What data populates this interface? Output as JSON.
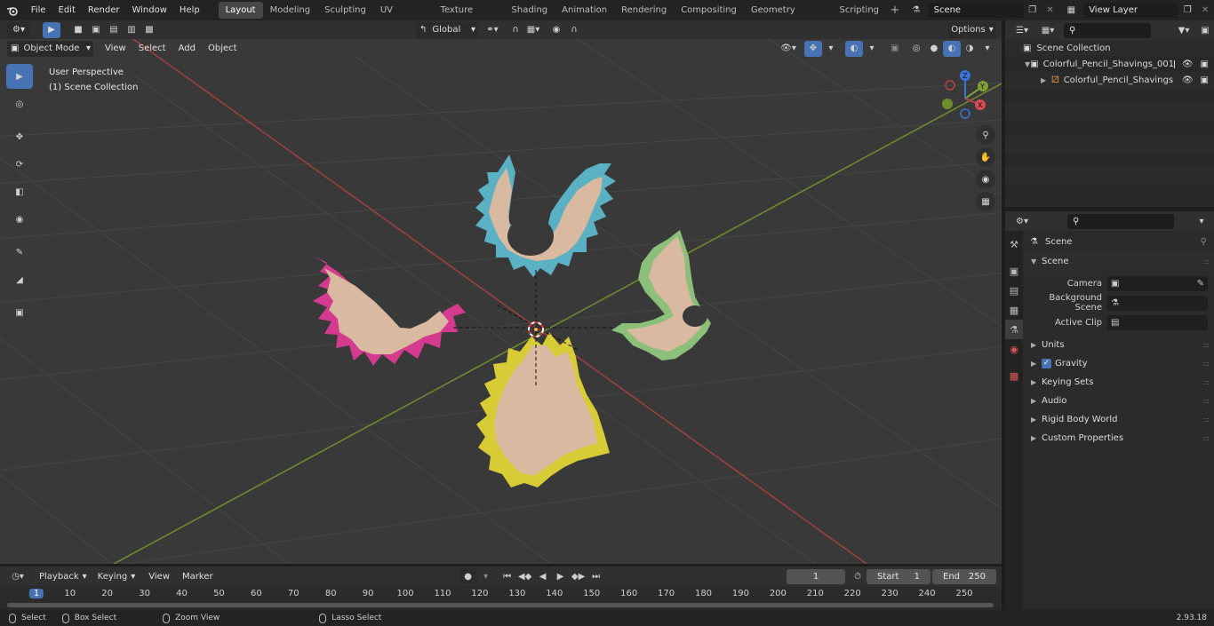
{
  "menus": [
    "File",
    "Edit",
    "Render",
    "Window",
    "Help"
  ],
  "workspaces": [
    {
      "label": "Layout",
      "active": true
    },
    {
      "label": "Modeling",
      "active": false
    },
    {
      "label": "Sculpting",
      "active": false
    },
    {
      "label": "UV Editing",
      "active": false
    },
    {
      "label": "Texture Paint",
      "active": false
    },
    {
      "label": "Shading",
      "active": false
    },
    {
      "label": "Animation",
      "active": false
    },
    {
      "label": "Rendering",
      "active": false
    },
    {
      "label": "Compositing",
      "active": false
    },
    {
      "label": "Geometry Nodes",
      "active": false
    },
    {
      "label": "Scripting",
      "active": false
    }
  ],
  "scene_field": "Scene",
  "view_layer_field": "View Layer",
  "viewport_header": {
    "mode": "Object Mode",
    "menus": [
      "View",
      "Select",
      "Add",
      "Object"
    ],
    "transform_orientation": "Global",
    "options": "Options"
  },
  "viewport_overlay": {
    "line1": "User Perspective",
    "line2": "(1) Scene Collection"
  },
  "gizmo_axes": {
    "z": "Z",
    "y": "Y",
    "x": "X"
  },
  "outliner": {
    "root": "Scene Collection",
    "collection": "Colorful_Pencil_Shavings_001",
    "object": "Colorful_Pencil_Shavings"
  },
  "properties": {
    "header": "Scene",
    "section": "Scene",
    "rows": [
      {
        "label": "Camera"
      },
      {
        "label": "Background Scene"
      },
      {
        "label": "Active Clip"
      }
    ],
    "panels": [
      "Units",
      "Gravity",
      "Keying Sets",
      "Audio",
      "Rigid Body World",
      "Custom Properties"
    ],
    "gravity_checked": true
  },
  "timeline": {
    "menus": [
      "Playback",
      "Keying",
      "View",
      "Marker"
    ],
    "current_frame": "1",
    "start_label": "Start",
    "start_value": "1",
    "end_label": "End",
    "end_value": "250",
    "ruler": [
      "1",
      "10",
      "20",
      "30",
      "40",
      "50",
      "60",
      "70",
      "80",
      "90",
      "100",
      "110",
      "120",
      "130",
      "140",
      "150",
      "160",
      "170",
      "180",
      "190",
      "200",
      "210",
      "220",
      "230",
      "240",
      "250"
    ]
  },
  "statusbar": {
    "select": "Select",
    "box_select": "Box Select",
    "zoom_view": "Zoom View",
    "lasso_select": "Lasso Select",
    "version": "2.93.18"
  },
  "colors": {
    "accent": "#4772b3",
    "x_axis": "#b8404a",
    "y_axis": "#7fa034",
    "z_axis": "#3b74d6",
    "shaving_pink": "#d43b8e",
    "shaving_blue": "#5bb1c4",
    "shaving_green": "#8cbf7a",
    "shaving_yellow": "#d8cc36",
    "wood": "#d9b9a0"
  }
}
